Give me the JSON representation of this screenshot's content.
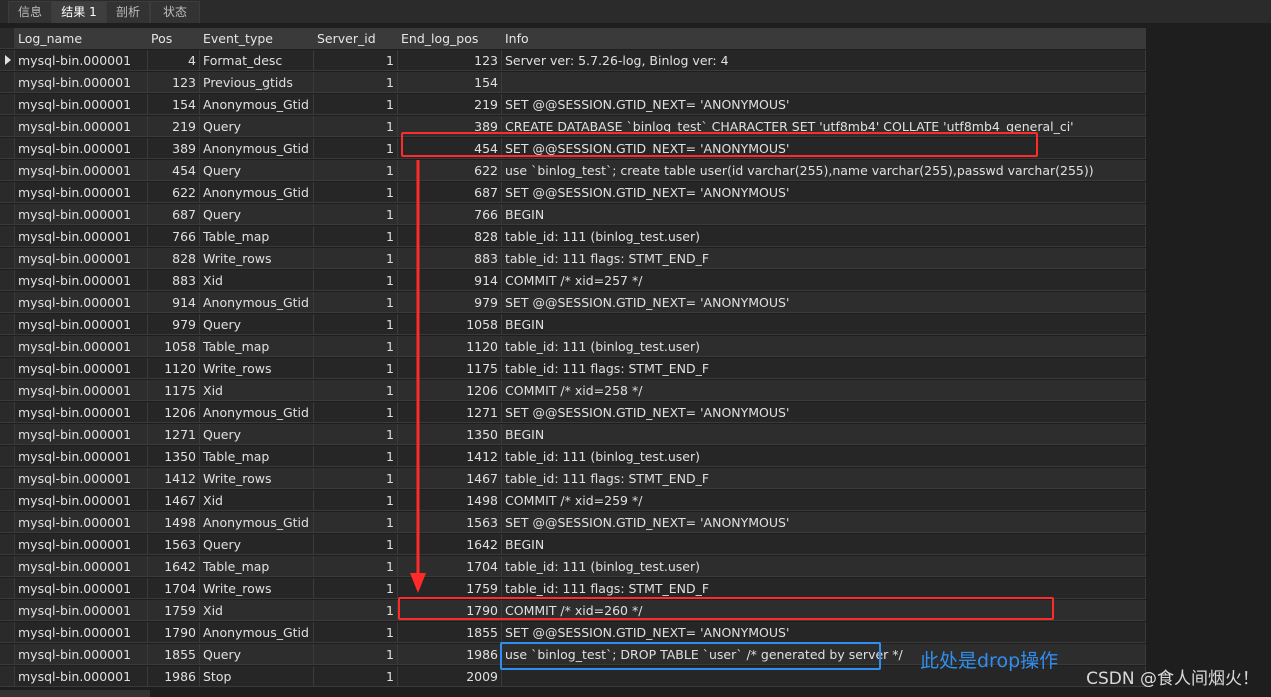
{
  "tabs": [
    "信息",
    "结果 1",
    "剖析",
    "状态"
  ],
  "columns": [
    "Log_name",
    "Pos",
    "Event_type",
    "Server_id",
    "End_log_pos",
    "Info"
  ],
  "rows": [
    [
      "mysql-bin.000001",
      "4",
      "Format_desc",
      "1",
      "123",
      "Server ver: 5.7.26-log, Binlog ver: 4"
    ],
    [
      "mysql-bin.000001",
      "123",
      "Previous_gtids",
      "1",
      "154",
      ""
    ],
    [
      "mysql-bin.000001",
      "154",
      "Anonymous_Gtid",
      "1",
      "219",
      "SET @@SESSION.GTID_NEXT= 'ANONYMOUS'"
    ],
    [
      "mysql-bin.000001",
      "219",
      "Query",
      "1",
      "389",
      "CREATE DATABASE `binlog_test` CHARACTER SET 'utf8mb4' COLLATE 'utf8mb4_general_ci'"
    ],
    [
      "mysql-bin.000001",
      "389",
      "Anonymous_Gtid",
      "1",
      "454",
      "SET @@SESSION.GTID_NEXT= 'ANONYMOUS'"
    ],
    [
      "mysql-bin.000001",
      "454",
      "Query",
      "1",
      "622",
      "use `binlog_test`; create table user(id varchar(255),name varchar(255),passwd varchar(255))"
    ],
    [
      "mysql-bin.000001",
      "622",
      "Anonymous_Gtid",
      "1",
      "687",
      "SET @@SESSION.GTID_NEXT= 'ANONYMOUS'"
    ],
    [
      "mysql-bin.000001",
      "687",
      "Query",
      "1",
      "766",
      "BEGIN"
    ],
    [
      "mysql-bin.000001",
      "766",
      "Table_map",
      "1",
      "828",
      "table_id: 111 (binlog_test.user)"
    ],
    [
      "mysql-bin.000001",
      "828",
      "Write_rows",
      "1",
      "883",
      "table_id: 111 flags: STMT_END_F"
    ],
    [
      "mysql-bin.000001",
      "883",
      "Xid",
      "1",
      "914",
      "COMMIT /* xid=257 */"
    ],
    [
      "mysql-bin.000001",
      "914",
      "Anonymous_Gtid",
      "1",
      "979",
      "SET @@SESSION.GTID_NEXT= 'ANONYMOUS'"
    ],
    [
      "mysql-bin.000001",
      "979",
      "Query",
      "1",
      "1058",
      "BEGIN"
    ],
    [
      "mysql-bin.000001",
      "1058",
      "Table_map",
      "1",
      "1120",
      "table_id: 111 (binlog_test.user)"
    ],
    [
      "mysql-bin.000001",
      "1120",
      "Write_rows",
      "1",
      "1175",
      "table_id: 111 flags: STMT_END_F"
    ],
    [
      "mysql-bin.000001",
      "1175",
      "Xid",
      "1",
      "1206",
      "COMMIT /* xid=258 */"
    ],
    [
      "mysql-bin.000001",
      "1206",
      "Anonymous_Gtid",
      "1",
      "1271",
      "SET @@SESSION.GTID_NEXT= 'ANONYMOUS'"
    ],
    [
      "mysql-bin.000001",
      "1271",
      "Query",
      "1",
      "1350",
      "BEGIN"
    ],
    [
      "mysql-bin.000001",
      "1350",
      "Table_map",
      "1",
      "1412",
      "table_id: 111 (binlog_test.user)"
    ],
    [
      "mysql-bin.000001",
      "1412",
      "Write_rows",
      "1",
      "1467",
      "table_id: 111 flags: STMT_END_F"
    ],
    [
      "mysql-bin.000001",
      "1467",
      "Xid",
      "1",
      "1498",
      "COMMIT /* xid=259 */"
    ],
    [
      "mysql-bin.000001",
      "1498",
      "Anonymous_Gtid",
      "1",
      "1563",
      "SET @@SESSION.GTID_NEXT= 'ANONYMOUS'"
    ],
    [
      "mysql-bin.000001",
      "1563",
      "Query",
      "1",
      "1642",
      "BEGIN"
    ],
    [
      "mysql-bin.000001",
      "1642",
      "Table_map",
      "1",
      "1704",
      "table_id: 111 (binlog_test.user)"
    ],
    [
      "mysql-bin.000001",
      "1704",
      "Write_rows",
      "1",
      "1759",
      "table_id: 111 flags: STMT_END_F"
    ],
    [
      "mysql-bin.000001",
      "1759",
      "Xid",
      "1",
      "1790",
      "COMMIT /* xid=260 */"
    ],
    [
      "mysql-bin.000001",
      "1790",
      "Anonymous_Gtid",
      "1",
      "1855",
      "SET @@SESSION.GTID_NEXT= 'ANONYMOUS'"
    ],
    [
      "mysql-bin.000001",
      "1855",
      "Query",
      "1",
      "1986",
      "use `binlog_test`; DROP TABLE `user` /* generated by server */"
    ],
    [
      "mysql-bin.000001",
      "1986",
      "Stop",
      "1",
      "2009",
      ""
    ]
  ],
  "annotation_text": "此处是drop操作",
  "watermark": "CSDN @食人间烟火！",
  "colors": {
    "highlight_red": "#ff2a2a",
    "highlight_blue": "#2f8ff0"
  }
}
